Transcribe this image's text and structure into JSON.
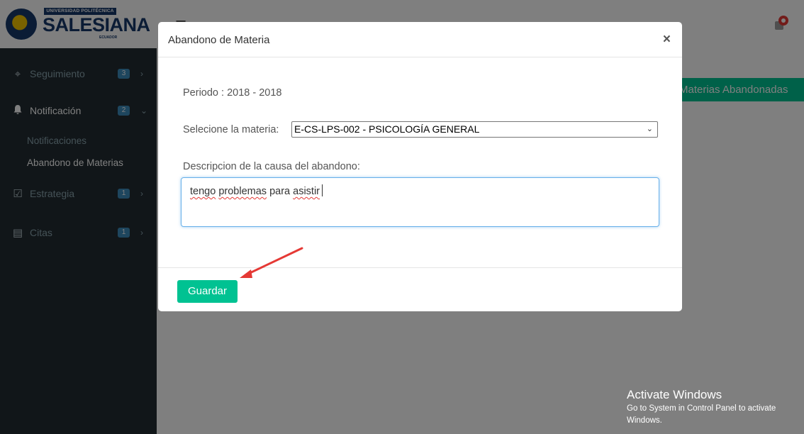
{
  "logo": {
    "top_text": "UNIVERSIDAD POLITÉCNICA",
    "name": "SALESIANA",
    "country": "ECUADOR"
  },
  "sidebar": {
    "items": [
      {
        "label": "Seguimiento",
        "badge": "3",
        "icon": "binoculars-icon"
      },
      {
        "label": "Notificación",
        "badge": "2",
        "icon": "bell-icon"
      },
      {
        "label": "Estrategia",
        "badge": "1",
        "icon": "check-square-icon"
      },
      {
        "label": "Citas",
        "badge": "1",
        "icon": "map-icon"
      }
    ],
    "subitems": [
      "Notificaciones",
      "Abandono de Materias"
    ]
  },
  "background": {
    "button_label": "Materias Abandonadas"
  },
  "modal": {
    "title": "Abandono de Materia",
    "close_symbol": "×",
    "periodo": "Periodo : 2018 - 2018",
    "select_label": "Selecione la materia:",
    "select_value": "E-CS-LPS-002 - PSICOLOGÍA GENERAL",
    "desc_label": "Descripcion de la causa del abandono:",
    "desc_value": [
      "tengo",
      "problemas",
      "para",
      "asistir"
    ],
    "save_label": "Guardar"
  },
  "watermark": {
    "title": "Activate Windows",
    "subtitle": "Go to System in Control Panel to activate Windows."
  },
  "colors": {
    "accent": "#00c292",
    "sidebar": "#222d32",
    "badge": "#3c8dbc",
    "brand": "#16386b",
    "annotation_arrow": "#e53935"
  }
}
